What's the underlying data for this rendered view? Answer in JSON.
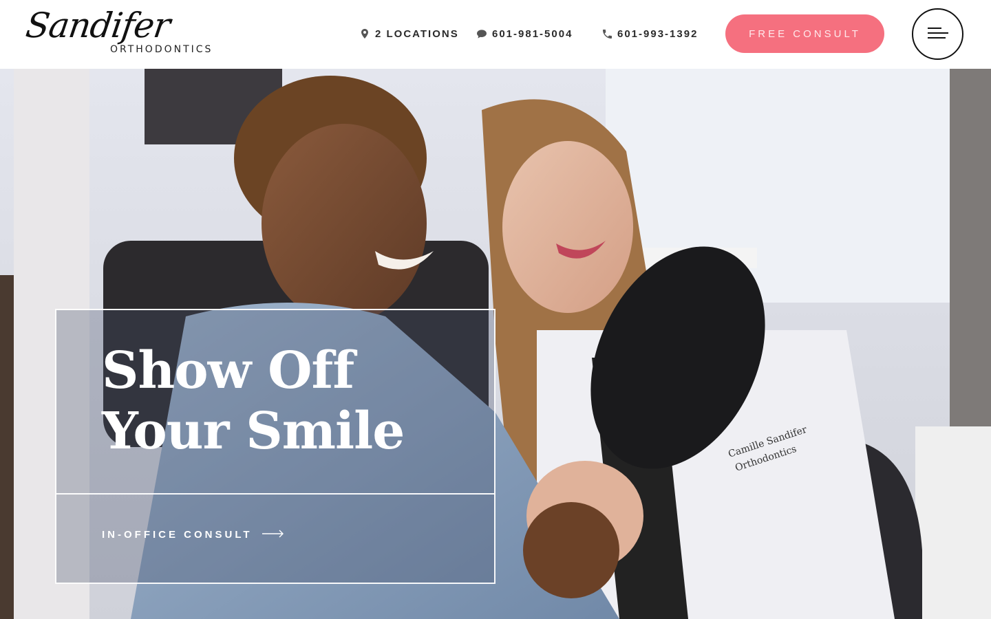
{
  "brand": {
    "logo_script": "Sandifer",
    "logo_sub": "ORTHODONTICS"
  },
  "nav": {
    "locations": {
      "label": "2 LOCATIONS",
      "icon": "map-pin-icon"
    },
    "text_line": {
      "label": "601-981-5004",
      "icon": "chat-bubble-icon"
    },
    "phone_line": {
      "label": "601-993-1392",
      "icon": "phone-icon"
    },
    "consult_button": "FREE CONSULT",
    "menu_icon": "hamburger-menu-icon"
  },
  "hero": {
    "title_line_1": "Show Off",
    "title_line_2": "Your Smile",
    "cta_label": "IN-OFFICE CONSULT",
    "cta_icon": "arrow-right-icon",
    "coat_embroidery_1": "Camille Sandifer",
    "coat_embroidery_2": "Orthodontics"
  },
  "colors": {
    "accent": "#f5707f",
    "text_dark": "#2a2a2a",
    "overlay_border": "#ffffff"
  }
}
